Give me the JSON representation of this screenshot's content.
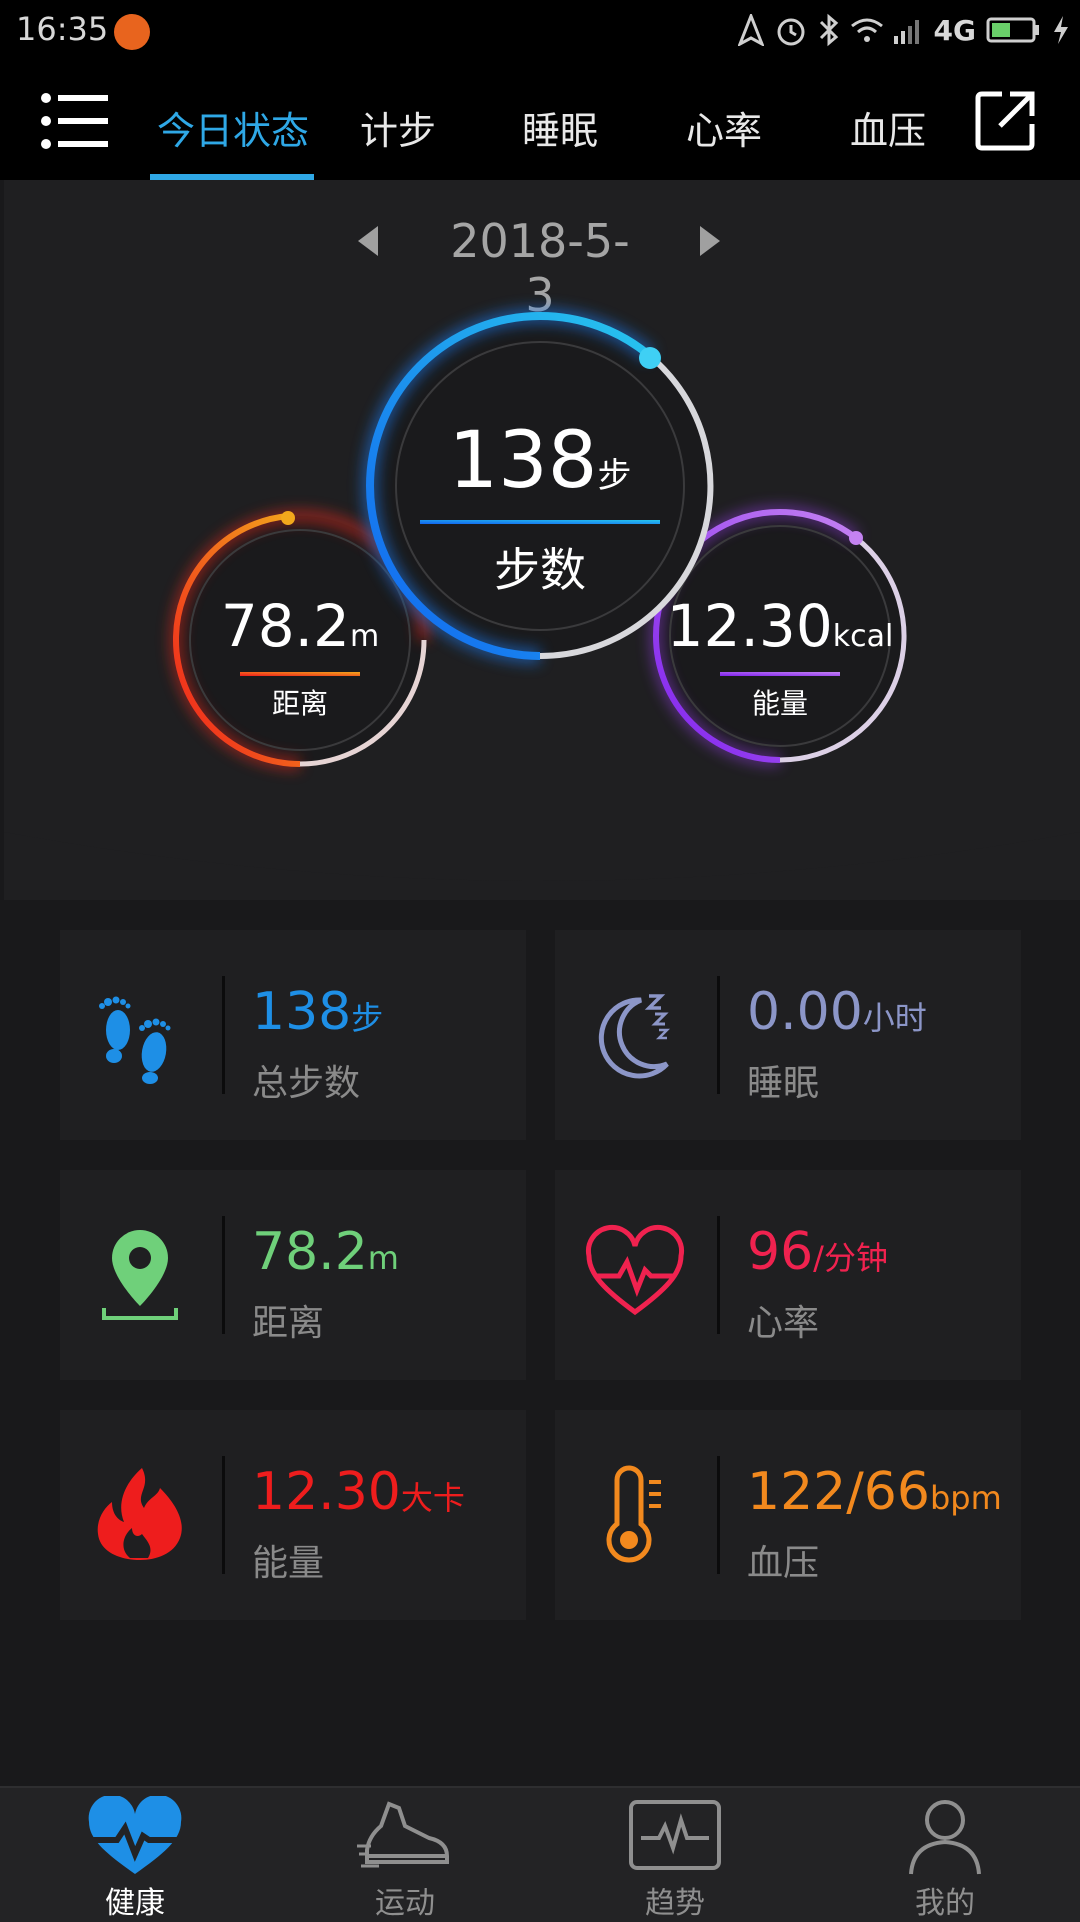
{
  "status_bar": {
    "time": "16:35",
    "network": "4G"
  },
  "top_nav": {
    "tabs": [
      {
        "label": "今日状态",
        "active": true
      },
      {
        "label": "计步"
      },
      {
        "label": "睡眠"
      },
      {
        "label": "心率"
      },
      {
        "label": "血压"
      }
    ]
  },
  "date_nav": {
    "date": "2018-5-3"
  },
  "rings": {
    "steps": {
      "value": "138",
      "unit": "步",
      "label": "步数"
    },
    "distance": {
      "value": "78.2",
      "unit": "m",
      "label": "距离"
    },
    "energy": {
      "value": "12.30",
      "unit": "kcal",
      "label": "能量"
    }
  },
  "cards": {
    "steps": {
      "value": "138",
      "unit": "步",
      "label": "总步数",
      "color": "#1e8fe6"
    },
    "sleep": {
      "value": "0.00",
      "unit": "小时",
      "label": "睡眠",
      "color": "#8c96c8"
    },
    "distance": {
      "value": "78.2",
      "unit": "m",
      "label": "距离",
      "color": "#6fd07a"
    },
    "heart_rate": {
      "value": "96",
      "unit": "/分钟",
      "label": "心率",
      "color": "#f0224f"
    },
    "energy": {
      "value": "12.30",
      "unit": "大卡",
      "label": "能量",
      "color": "#ee1d1d"
    },
    "blood_pressure": {
      "value": "122/66",
      "unit": "bpm",
      "label": "血压",
      "color": "#f2891e"
    }
  },
  "bottom_nav": {
    "items": [
      {
        "label": "健康",
        "icon": "heart-pulse-icon",
        "active": true
      },
      {
        "label": "运动",
        "icon": "shoe-icon"
      },
      {
        "label": "趋势",
        "icon": "trend-chart-icon"
      },
      {
        "label": "我的",
        "icon": "person-icon"
      }
    ]
  },
  "colors": {
    "accent": "#2fa8e6",
    "steps_ring": "#1a7bf0",
    "distance_ring": "#f0361e",
    "energy_ring": "#9c3ff0"
  }
}
